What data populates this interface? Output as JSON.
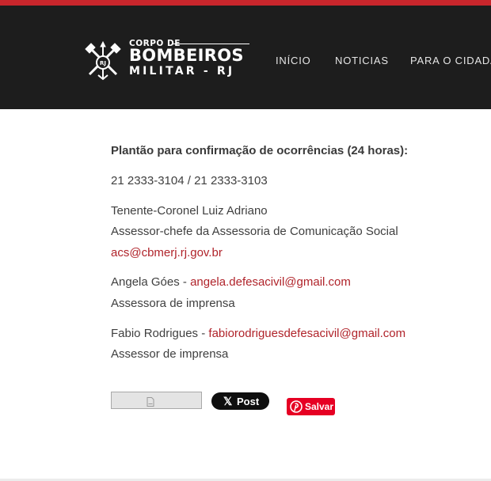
{
  "header": {
    "logo": {
      "line1": "CORPO DE",
      "line2": "BOMBEIROS",
      "line3": "MILITAR - RJ",
      "emblem_icon": "firefighter-axes-emblem-icon"
    },
    "nav": [
      {
        "label": "INÍCIO"
      },
      {
        "label": "NOTICIAS"
      },
      {
        "label": "PARA O CIDADÃO"
      }
    ]
  },
  "content": {
    "heading": "Plantão para confirmação de ocorrências (24 horas):",
    "phones": "21 2333-3104 / 21 2333-3103",
    "contact1": {
      "name": "Tenente-Coronel Luiz Adriano",
      "role": "Assessor-chefe da Assessoria de Comunicação Social",
      "email": "acs@cbmerj.rj.gov.br"
    },
    "contact2": {
      "name": "Angela Góes - ",
      "email": "angela.defesacivil@gmail.com",
      "role": "Assessora de imprensa"
    },
    "contact3": {
      "name": "Fabio Rodrigues - ",
      "email": "fabiorodriguesdefesacivil@gmail.com",
      "role": "Assessor de imprensa"
    }
  },
  "share": {
    "x_label": "Post",
    "x_glyph": "𝕏",
    "pin_label": "Salvar",
    "colors": {
      "x": "#0f0f0f",
      "pinterest": "#e60023",
      "link": "#b0232a",
      "topbar": "#c8262c",
      "header": "#1d1d1d"
    }
  }
}
